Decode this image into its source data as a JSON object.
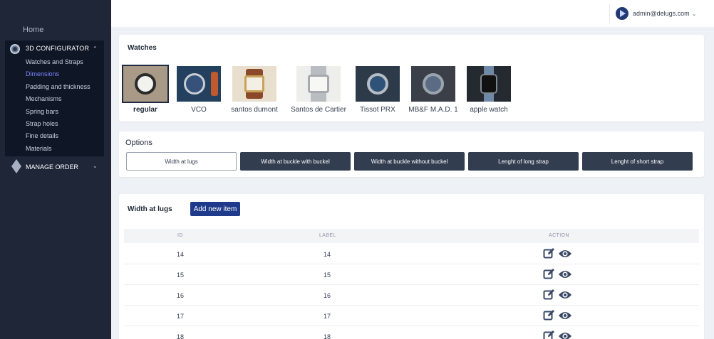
{
  "sidebar": {
    "home_label": "Home",
    "configurator": {
      "title": "3D CONFIGURATOR",
      "items": [
        {
          "label": "Watches and Straps",
          "active": false
        },
        {
          "label": "Dimensions",
          "active": true
        },
        {
          "label": "Padding and thickness",
          "active": false
        },
        {
          "label": "Mechanisms",
          "active": false
        },
        {
          "label": "Spring bars",
          "active": false
        },
        {
          "label": "Strap holes",
          "active": false
        },
        {
          "label": "Fine details",
          "active": false
        },
        {
          "label": "Materials",
          "active": false
        }
      ]
    },
    "manage_order_label": "MANAGE ORDER"
  },
  "topbar": {
    "user_email": "admin@delugs.com"
  },
  "watches": {
    "title": "Watches",
    "items": [
      {
        "name": "regular",
        "selected": true
      },
      {
        "name": "VCO",
        "selected": false
      },
      {
        "name": "santos dumont",
        "selected": false
      },
      {
        "name": "Santos de Cartier",
        "selected": false
      },
      {
        "name": "Tissot PRX",
        "selected": false
      },
      {
        "name": "MB&F M.A.D. 1",
        "selected": false
      },
      {
        "name": "apple watch",
        "selected": false
      }
    ]
  },
  "options": {
    "title": "Options",
    "buttons": [
      {
        "label": "Width at lugs",
        "selected": true
      },
      {
        "label": "Width at buckle with buckel",
        "selected": false
      },
      {
        "label": "Width at buckle without buckel",
        "selected": false
      },
      {
        "label": "Lenght of long strap",
        "selected": false
      },
      {
        "label": "Lenght of short strap",
        "selected": false
      }
    ]
  },
  "table": {
    "title": "Width at lugs",
    "add_button_label": "Add new item",
    "columns": [
      "ID",
      "LABEL",
      "ACTION"
    ],
    "rows": [
      {
        "id": "14",
        "label": "14"
      },
      {
        "id": "15",
        "label": "15"
      },
      {
        "id": "16",
        "label": "16"
      },
      {
        "id": "17",
        "label": "17"
      },
      {
        "id": "18",
        "label": "18"
      }
    ]
  },
  "colors": {
    "sidebar_bg": "#1e2638",
    "active_link": "#7b86ff",
    "primary_button": "#1f3a8a",
    "option_button": "#323d50",
    "icon": "#3a4a66"
  }
}
